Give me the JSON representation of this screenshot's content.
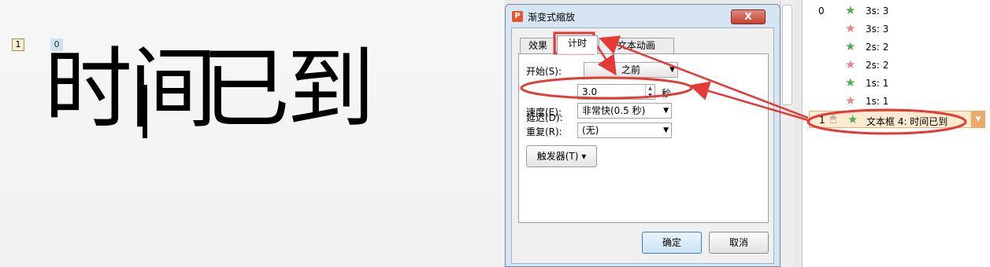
{
  "slide": {
    "tag1": "1",
    "tag0": "0",
    "text_part_a": "时间",
    "text_part_b": "已到"
  },
  "dialog": {
    "title": "渐变式缩放",
    "close": "X",
    "tabs": [
      "效果",
      "计时",
      "正文文本动画"
    ],
    "tab_text_visible": "文本动画",
    "start_label": "开始(S):",
    "start_value": "之前",
    "delay_label": "延迟(D):",
    "delay_value": "3.0",
    "delay_unit": "秒",
    "speed_label": "速度(E):",
    "speed_value": "非常快(0.5 秒)",
    "repeat_label": "重复(R):",
    "repeat_value": "(无)",
    "trigger_label": "触发器(T)",
    "ok": "确定",
    "cancel": "取消"
  },
  "animation_list": {
    "items": [
      {
        "idx": "0",
        "label": "3s: 3",
        "star": "green"
      },
      {
        "idx": "",
        "label": "3s: 3",
        "star": "red"
      },
      {
        "idx": "",
        "label": "2s: 2",
        "star": "green"
      },
      {
        "idx": "",
        "label": "2s: 2",
        "star": "red"
      },
      {
        "idx": "",
        "label": "1s: 1",
        "star": "green"
      },
      {
        "idx": "",
        "label": "1s: 1",
        "star": "red"
      }
    ],
    "selected": {
      "idx": "1",
      "label": "文本框 4: 时间已到"
    }
  },
  "colors": {
    "highlight_red": "#e53935",
    "selected_row": "#fdebd0",
    "dialog_frame": "#d7e4f2"
  }
}
